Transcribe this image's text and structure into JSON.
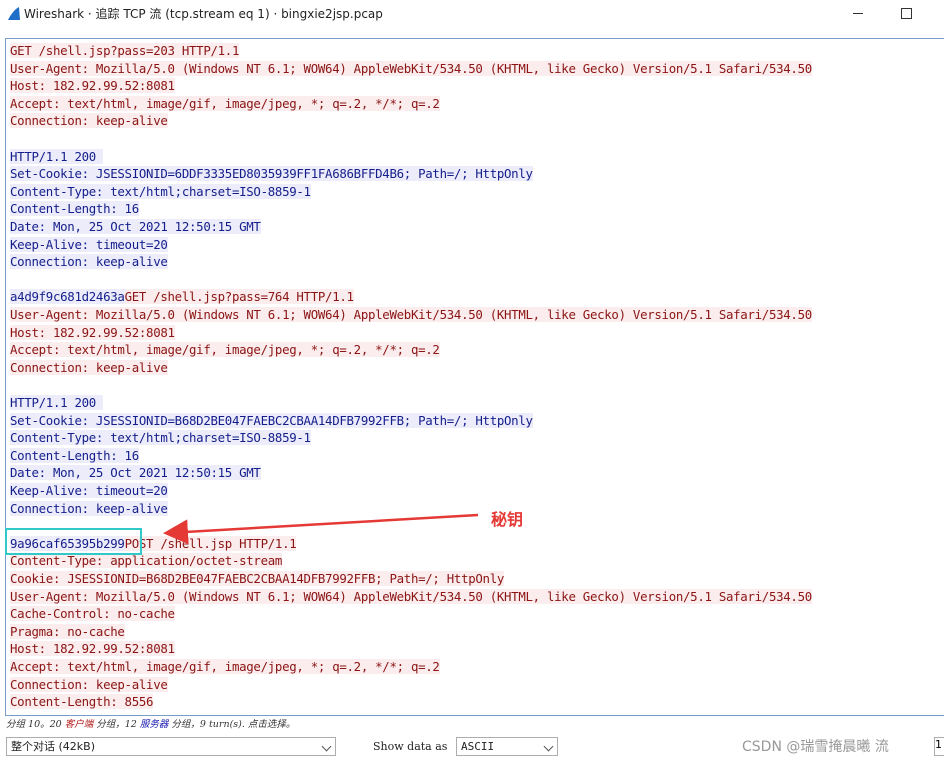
{
  "window": {
    "title": "Wireshark · 追踪 TCP 流 (tcp.stream eq 1) · bingxie2jsp.pcap",
    "icon": "wireshark-fin-icon"
  },
  "stream_lines": [
    {
      "dir": "client",
      "text": "GET /shell.jsp?pass=203 HTTP/1.1"
    },
    {
      "dir": "client",
      "text": "User-Agent: Mozilla/5.0 (Windows NT 6.1; WOW64) AppleWebKit/534.50 (KHTML, like Gecko) Version/5.1 Safari/534.50"
    },
    {
      "dir": "client",
      "text": "Host: 182.92.99.52:8081"
    },
    {
      "dir": "client",
      "text": "Accept: text/html, image/gif, image/jpeg, *; q=.2, */*; q=.2"
    },
    {
      "dir": "client",
      "text": "Connection: keep-alive"
    },
    {
      "dir": "blank",
      "text": ""
    },
    {
      "dir": "server",
      "text": "HTTP/1.1 200 "
    },
    {
      "dir": "server",
      "text": "Set-Cookie: JSESSIONID=6DDF3335ED8035939FF1FA686BFFD4B6; Path=/; HttpOnly"
    },
    {
      "dir": "server",
      "text": "Content-Type: text/html;charset=ISO-8859-1"
    },
    {
      "dir": "server",
      "text": "Content-Length: 16"
    },
    {
      "dir": "server",
      "text": "Date: Mon, 25 Oct 2021 12:50:15 GMT"
    },
    {
      "dir": "server",
      "text": "Keep-Alive: timeout=20"
    },
    {
      "dir": "server",
      "text": "Connection: keep-alive"
    },
    {
      "dir": "blank",
      "text": ""
    },
    {
      "dir": "server",
      "text": "a4d9f9c681d2463a",
      "rest_dir": "client",
      "rest": "GET /shell.jsp?pass=764 HTTP/1.1"
    },
    {
      "dir": "client",
      "text": "User-Agent: Mozilla/5.0 (Windows NT 6.1; WOW64) AppleWebKit/534.50 (KHTML, like Gecko) Version/5.1 Safari/534.50"
    },
    {
      "dir": "client",
      "text": "Host: 182.92.99.52:8081"
    },
    {
      "dir": "client",
      "text": "Accept: text/html, image/gif, image/jpeg, *; q=.2, */*; q=.2"
    },
    {
      "dir": "client",
      "text": "Connection: keep-alive"
    },
    {
      "dir": "blank",
      "text": ""
    },
    {
      "dir": "server",
      "text": "HTTP/1.1 200 "
    },
    {
      "dir": "server",
      "text": "Set-Cookie: JSESSIONID=B68D2BE047FAEBC2CBAA14DFB7992FFB; Path=/; HttpOnly"
    },
    {
      "dir": "server",
      "text": "Content-Type: text/html;charset=ISO-8859-1"
    },
    {
      "dir": "server",
      "text": "Content-Length: 16"
    },
    {
      "dir": "server",
      "text": "Date: Mon, 25 Oct 2021 12:50:15 GMT"
    },
    {
      "dir": "server",
      "text": "Keep-Alive: timeout=20"
    },
    {
      "dir": "server",
      "text": "Connection: keep-alive"
    },
    {
      "dir": "blank",
      "text": ""
    },
    {
      "dir": "server",
      "text": "9a96caf65395b299",
      "rest_dir": "client",
      "rest": "POST /shell.jsp HTTP/1.1"
    },
    {
      "dir": "client",
      "text": "Content-Type: application/octet-stream"
    },
    {
      "dir": "client",
      "text": "Cookie: JSESSIONID=B68D2BE047FAEBC2CBAA14DFB7992FFB; Path=/; HttpOnly"
    },
    {
      "dir": "client",
      "text": "User-Agent: Mozilla/5.0 (Windows NT 6.1; WOW64) AppleWebKit/534.50 (KHTML, like Gecko) Version/5.1 Safari/534.50"
    },
    {
      "dir": "client",
      "text": "Cache-Control: no-cache"
    },
    {
      "dir": "client",
      "text": "Pragma: no-cache"
    },
    {
      "dir": "client",
      "text": "Host: 182.92.99.52:8081"
    },
    {
      "dir": "client",
      "text": "Accept: text/html, image/gif, image/jpeg, *; q=.2, */*; q=.2"
    },
    {
      "dir": "client",
      "text": "Connection: keep-alive"
    },
    {
      "dir": "client",
      "text": "Content-Length: 8556"
    }
  ],
  "annotation": {
    "label": "秘钥",
    "color": "#e53935",
    "box_color": "#30c8c8"
  },
  "status": {
    "prefix": "分组 10。20 ",
    "client_label": "客户端",
    "middle": " 分组，12 ",
    "server_label": "服务器",
    "suffix": " 分组，9 turn(s). 点击选择。"
  },
  "bottom": {
    "conversation_select": "整个对话 (42kB)",
    "show_label": "Show data as",
    "encoding_select": "ASCII",
    "watermark": "CSDN @瑞雪掩晨曦",
    "stream_partial": "流",
    "stream_value": "1"
  },
  "colors": {
    "client_text": "#8b1414",
    "client_bg": "#fbeded",
    "server_text": "#141e8b",
    "server_bg": "#ececfb"
  }
}
